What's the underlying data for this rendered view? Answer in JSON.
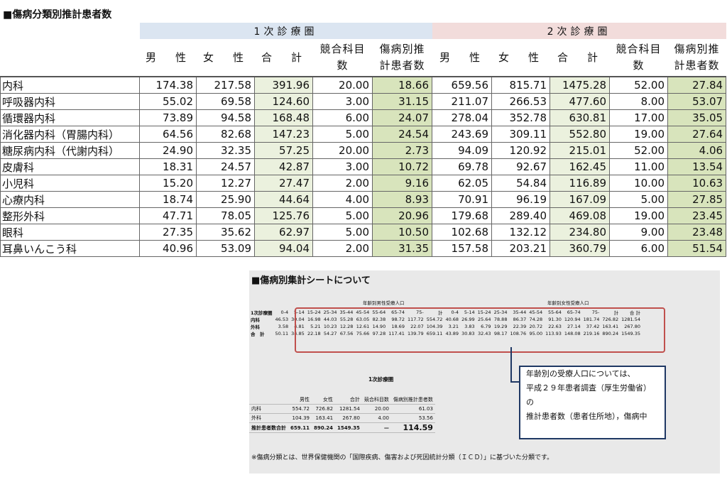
{
  "title": "■傷病分類別推計患者数",
  "group1": "1次診療圏",
  "group2": "2次診療圏",
  "columns": [
    "男性",
    "女性",
    "合計",
    "競合科目数",
    "傷病別推計患者数"
  ],
  "col_male": "男　性",
  "col_female": "女　性",
  "col_total": "合　計",
  "col_comp_1": "競合科目",
  "col_comp_2": "数",
  "col_est_1": "傷病別推",
  "col_est_2": "計患者数",
  "rows": [
    {
      "name": "内科",
      "v": [
        "174.38",
        "217.58",
        "391.96",
        "20.00",
        "18.66",
        "659.56",
        "815.71",
        "1475.28",
        "52.00",
        "27.84"
      ]
    },
    {
      "name": "呼吸器内科",
      "v": [
        "55.02",
        "69.58",
        "124.60",
        "3.00",
        "31.15",
        "211.07",
        "266.53",
        "477.60",
        "8.00",
        "53.07"
      ]
    },
    {
      "name": "循環器内科",
      "v": [
        "73.89",
        "94.58",
        "168.48",
        "6.00",
        "24.07",
        "278.04",
        "352.78",
        "630.81",
        "17.00",
        "35.05"
      ]
    },
    {
      "name": "消化器内科（胃腸内科）",
      "v": [
        "64.56",
        "82.68",
        "147.23",
        "5.00",
        "24.54",
        "243.69",
        "309.11",
        "552.80",
        "19.00",
        "27.64"
      ]
    },
    {
      "name": "糖尿病内科（代謝内科）",
      "v": [
        "24.90",
        "32.35",
        "57.25",
        "20.00",
        "2.73",
        "94.09",
        "120.92",
        "215.01",
        "52.00",
        "4.06"
      ]
    },
    {
      "name": "皮膚科",
      "v": [
        "18.31",
        "24.57",
        "42.87",
        "3.00",
        "10.72",
        "69.78",
        "92.67",
        "162.45",
        "11.00",
        "13.54"
      ]
    },
    {
      "name": "小児科",
      "v": [
        "15.20",
        "12.27",
        "27.47",
        "2.00",
        "9.16",
        "62.05",
        "54.84",
        "116.89",
        "10.00",
        "10.63"
      ]
    },
    {
      "name": "心療内科",
      "v": [
        "18.74",
        "25.90",
        "44.64",
        "4.00",
        "8.93",
        "70.91",
        "96.19",
        "167.09",
        "5.00",
        "27.85"
      ]
    },
    {
      "name": "整形外科",
      "v": [
        "47.71",
        "78.05",
        "125.76",
        "5.00",
        "20.96",
        "179.68",
        "289.40",
        "469.08",
        "19.00",
        "23.45"
      ]
    },
    {
      "name": "眼科",
      "v": [
        "27.35",
        "35.62",
        "62.97",
        "5.00",
        "10.50",
        "102.68",
        "132.12",
        "234.80",
        "9.00",
        "23.48"
      ]
    },
    {
      "name": "耳鼻いんこう科",
      "v": [
        "40.96",
        "53.09",
        "94.04",
        "2.00",
        "31.35",
        "157.58",
        "203.21",
        "360.79",
        "6.00",
        "51.54"
      ]
    }
  ],
  "inset": {
    "title": "■傷病別集計シートについて",
    "male_pop_label": "年齢別男性受療人口",
    "female_pop_label": "年齢別女性受療人口",
    "area_label": "1次診療圏",
    "ages": [
      "0-4",
      "5-14",
      "15-24",
      "25-34",
      "35-44",
      "45-54",
      "55-64",
      "65-74",
      "75-",
      "計"
    ],
    "total_label": "合 計",
    "rows": [
      {
        "name": "内科",
        "m": [
          "46.53",
          "30.04",
          "16.98",
          "44.03",
          "55.28",
          "63.05",
          "82.38",
          "98.72",
          "117.72",
          "554.72"
        ],
        "f": [
          "40.68",
          "26.99",
          "25.64",
          "78.88",
          "86.37",
          "74.28",
          "91.30",
          "120.94",
          "181.74",
          "726.82"
        ],
        "t": "1281.54"
      },
      {
        "name": "外科",
        "m": [
          "3.58",
          "4.81",
          "5.21",
          "10.23",
          "12.28",
          "12.61",
          "14.90",
          "18.69",
          "22.07",
          "104.39"
        ],
        "f": [
          "3.21",
          "3.83",
          "6.79",
          "19.29",
          "22.39",
          "20.72",
          "22.63",
          "27.14",
          "37.42",
          "163.41"
        ],
        "t": "267.80"
      },
      {
        "name": "合　計",
        "m": [
          "50.11",
          "34.85",
          "22.18",
          "54.27",
          "67.56",
          "75.66",
          "97.28",
          "117.41",
          "139.79",
          "659.11"
        ],
        "f": [
          "43.89",
          "30.83",
          "32.43",
          "98.17",
          "108.76",
          "95.00",
          "113.93",
          "148.08",
          "219.16",
          "890.24"
        ],
        "t": "1549.35"
      }
    ],
    "mini_title": "1次診療圏",
    "mini_headers": [
      "男性",
      "女性",
      "合計",
      "競合科目数",
      "傷病別推計患者数"
    ],
    "mini_rows": [
      {
        "name": "内科",
        "v": [
          "554.72",
          "726.82",
          "1281.54",
          "20.00",
          "61.03"
        ]
      },
      {
        "name": "外科",
        "v": [
          "104.39",
          "163.41",
          "267.80",
          "4.00",
          "53.56"
        ]
      },
      {
        "name": "推計患者数合計",
        "v": [
          "659.11",
          "890.24",
          "1549.35",
          "—",
          "114.59"
        ]
      }
    ],
    "callout": [
      "年齢別の受療人口については、",
      "平成２９年患者調査（厚生労働省）",
      "の",
      "推計患者数（患者住所地），傷病中"
    ],
    "note": "※傷病分類とは、世界保健機関の「国際疾病、傷害および死因統計分類（ＩＣＤ）」に基づいた分類です。"
  }
}
